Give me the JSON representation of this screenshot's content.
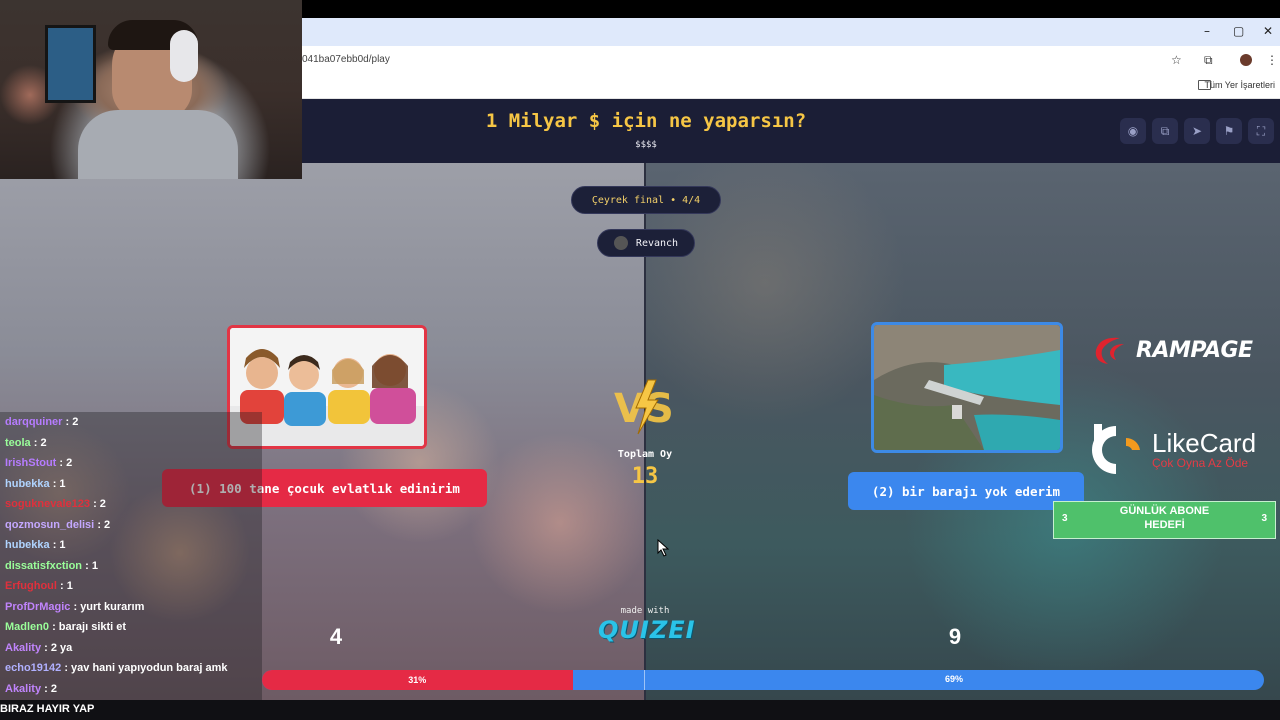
{
  "browser": {
    "url": "041ba07ebb0d/play",
    "bookmarks_label": "Tüm Yer İşaretleri",
    "window_controls": [
      "–",
      "▢",
      "✕"
    ]
  },
  "quiz": {
    "title": "1 Milyar $ için ne yaparsın?",
    "subtitle": "$$$$",
    "round_label": "Çeyrek final • 4/4",
    "revanch_label": "Revanch",
    "total_label": "Toplam Oy",
    "total_votes": "13",
    "made_with": "made with",
    "brand": "QUIZEI",
    "left": {
      "label": "(1) 100 tane çocuk evlatlık edinirim",
      "votes": "4",
      "percent_label": "31%",
      "percent": 31
    },
    "right": {
      "label": "(2) bir barajı yok ederim",
      "votes": "9",
      "percent_label": "69%",
      "percent": 69
    },
    "header_icons": [
      "eye-icon",
      "share-icon",
      "send-icon",
      "flag-icon",
      "fullscreen-icon"
    ],
    "colors": {
      "accent": "#f6c645",
      "left": "#e52a45",
      "right": "#3b87ee",
      "header": "#1b1e36"
    }
  },
  "chat": {
    "messages": [
      {
        "user": "darqquiner",
        "text": ": 2",
        "color": "#b67cff"
      },
      {
        "user": "teola",
        "text": ": 2",
        "color": "#9aff9a"
      },
      {
        "user": "IrishStout",
        "text": ": 2",
        "color": "#b67cff"
      },
      {
        "user": "hubekka",
        "text": ": 1",
        "color": "#b0d4ff"
      },
      {
        "user": "soguknevale123",
        "text": ": 2",
        "color": "#e0303c"
      },
      {
        "user": "qozmosun_delisi",
        "text": ": 2",
        "color": "#c4a8ff"
      },
      {
        "user": "hubekka",
        "text": ": 1",
        "color": "#b0d4ff"
      },
      {
        "user": "dissatisfxction",
        "text": ": 1",
        "color": "#9aff9a"
      },
      {
        "user": "Erfughoul",
        "text": ": 1",
        "color": "#e0303c"
      },
      {
        "user": "ProfDrMagic",
        "text": ": yurt kurarım",
        "color": "#c084fc"
      },
      {
        "user": "Madlen0",
        "text": ": barajı sikti et",
        "color": "#9aff9a"
      },
      {
        "user": "Akality",
        "text": ": 2 ya",
        "color": "#c084fc"
      },
      {
        "user": "echo19142",
        "text": ": yav hani yapıyodun baraj amk",
        "color": "#b0b0ff"
      },
      {
        "user": "Akality",
        "text": ": 2",
        "color": "#c084fc"
      }
    ],
    "bottom_text": "BIRAZ HAYIR YAP"
  },
  "sponsors": {
    "rampage": "RAMPAGE",
    "likecard": "LikeCard",
    "likecard_slogan": "Çok Oyna  Az Öde",
    "goal_title": "GÜNLÜK ABONE",
    "goal_subtitle": "HEDEFİ",
    "goal_left": "3",
    "goal_right": "3"
  }
}
